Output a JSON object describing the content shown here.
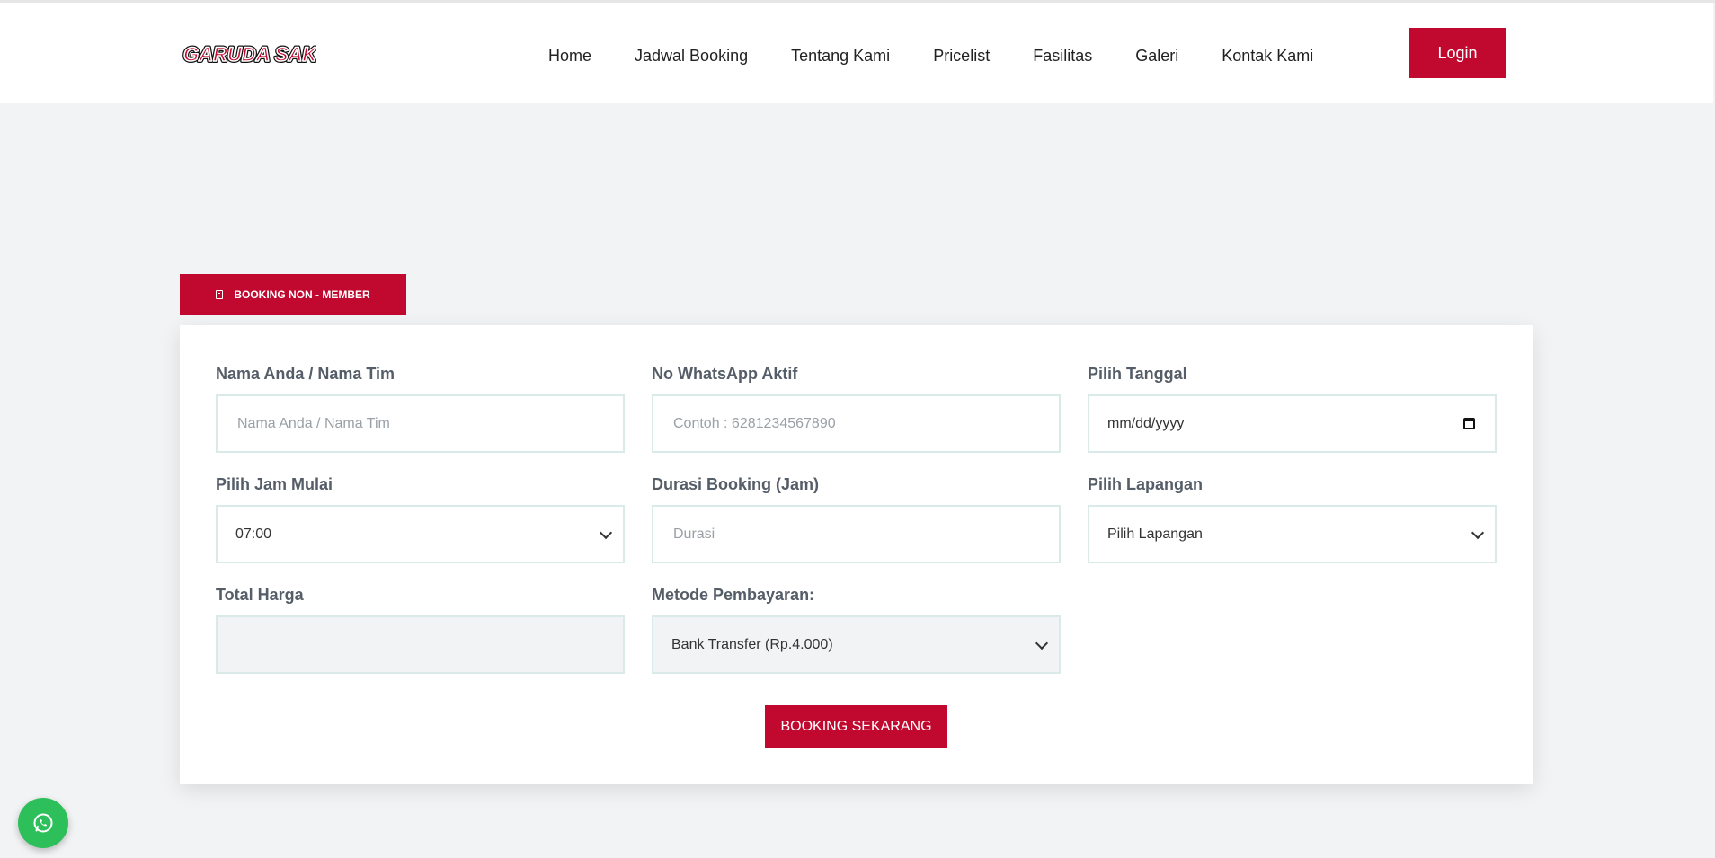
{
  "brand": {
    "logo_text": "GARUDA SAKTI",
    "accent_color": "#c1092f"
  },
  "nav": {
    "items": [
      "Home",
      "Jadwal Booking",
      "Tentang Kami",
      "Pricelist",
      "Fasilitas",
      "Galeri",
      "Kontak Kami"
    ],
    "login_label": "Login"
  },
  "tab": {
    "label": "BOOKING NON - MEMBER",
    "icon": "receipt-icon"
  },
  "form": {
    "nama": {
      "label": "Nama Anda / Nama Tim",
      "placeholder": "Nama Anda / Nama Tim",
      "value": ""
    },
    "whatsapp": {
      "label": "No WhatsApp Aktif",
      "placeholder": "Contoh : 6281234567890",
      "value": ""
    },
    "tanggal": {
      "label": "Pilih Tanggal",
      "value": "mm/dd/yyyy"
    },
    "jam_mulai": {
      "label": "Pilih Jam Mulai",
      "value": "07:00"
    },
    "durasi": {
      "label": "Durasi Booking (Jam)",
      "placeholder": "Durasi",
      "value": ""
    },
    "lapangan": {
      "label": "Pilih Lapangan",
      "value": "Pilih Lapangan"
    },
    "total_harga": {
      "label": "Total Harga",
      "value": ""
    },
    "metode": {
      "label": "Metode Pembayaran:",
      "value": "Bank Transfer (Rp.4.000)"
    },
    "submit_label": "BOOKING SEKARANG"
  },
  "whatsapp_button": {
    "icon": "whatsapp-icon",
    "color": "#2dbf5a"
  }
}
